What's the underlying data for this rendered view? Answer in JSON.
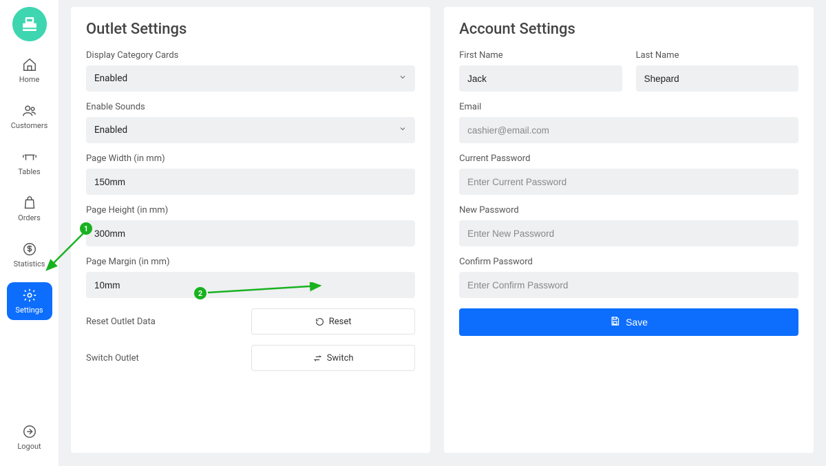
{
  "sidebar": {
    "items": [
      {
        "label": "Home",
        "icon": "home-icon"
      },
      {
        "label": "Customers",
        "icon": "users-icon"
      },
      {
        "label": "Tables",
        "icon": "table-icon"
      },
      {
        "label": "Orders",
        "icon": "bag-icon"
      },
      {
        "label": "Statistics",
        "icon": "dollar-icon"
      },
      {
        "label": "Settings",
        "icon": "gear-icon"
      }
    ],
    "logout_label": "Logout"
  },
  "outlet": {
    "title": "Outlet Settings",
    "display_cards_label": "Display Category Cards",
    "display_cards_value": "Enabled",
    "enable_sounds_label": "Enable Sounds",
    "enable_sounds_value": "Enabled",
    "page_width_label": "Page Width (in mm)",
    "page_width_value": "150mm",
    "page_height_label": "Page Height (in mm)",
    "page_height_value": "300mm",
    "page_margin_label": "Page Margin (in mm)",
    "page_margin_value": "10mm",
    "reset_label": "Reset Outlet Data",
    "reset_button": "Reset",
    "switch_label": "Switch Outlet",
    "switch_button": "Switch"
  },
  "account": {
    "title": "Account Settings",
    "first_name_label": "First Name",
    "first_name_value": "Jack",
    "last_name_label": "Last Name",
    "last_name_value": "Shepard",
    "email_label": "Email",
    "email_placeholder": "cashier@email.com",
    "current_pw_label": "Current Password",
    "current_pw_placeholder": "Enter Current Password",
    "new_pw_label": "New Password",
    "new_pw_placeholder": "Enter New Password",
    "confirm_pw_label": "Confirm Password",
    "confirm_pw_placeholder": "Enter Confirm Password",
    "save_label": "Save"
  },
  "annotations": {
    "badge1": "1",
    "badge2": "2"
  }
}
